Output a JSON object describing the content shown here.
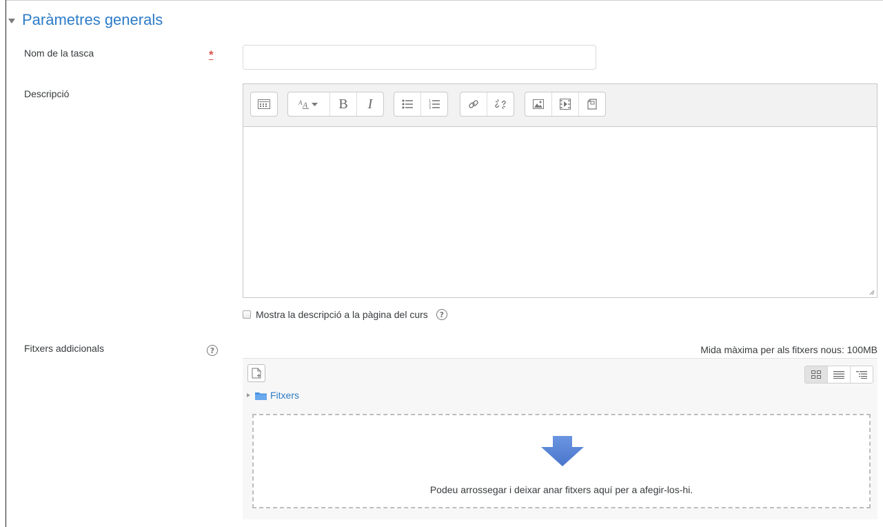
{
  "section": {
    "title": "Paràmetres generals"
  },
  "form": {
    "name_label": "Nom de la tasca",
    "required_marker": "*",
    "name_value": "",
    "description_label": "Descripció",
    "show_description_label": "Mostra la descripció a la pàgina del curs",
    "show_description_checked": false,
    "files_label": "Fitxers addicionals",
    "max_size": "Mida màxima per als fitxers nous: 100MB"
  },
  "editor": {
    "toolbar_buttons": [
      "toolbar-toggle-icon",
      "font-size-icon",
      "bold",
      "italic",
      "unordered-list-icon",
      "ordered-list-icon",
      "link-icon",
      "unlink-icon",
      "image-icon",
      "media-icon",
      "file-manage-icon"
    ],
    "bold_glyph": "B",
    "italic_glyph": "I",
    "content": ""
  },
  "filemanager": {
    "folder_name": "Fitxers",
    "drop_message": "Podeu arrossegar i deixar anar fitxers aquí per a afegir-los-hi.",
    "help_glyph": "?",
    "views": [
      "icons-view-icon",
      "list-view-icon",
      "tree-view-icon"
    ],
    "active_view": "icons-view-icon",
    "accent_color": "#2c7bc7",
    "arrow_color": "#5b84d6"
  }
}
